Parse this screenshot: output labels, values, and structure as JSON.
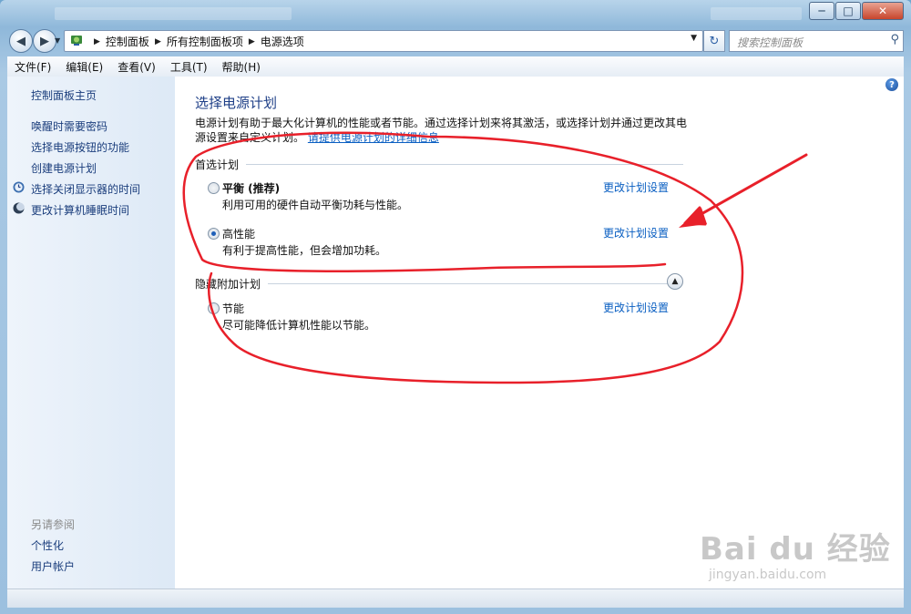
{
  "window": {
    "controls": {
      "minimize": "─",
      "maximize": "□",
      "close": "✕"
    }
  },
  "address": {
    "crumbs": [
      "控制面板",
      "所有控制面板项",
      "电源选项"
    ],
    "search_placeholder": "搜索控制面板"
  },
  "menu": [
    "文件(F)",
    "编辑(E)",
    "查看(V)",
    "工具(T)",
    "帮助(H)"
  ],
  "sidebar": {
    "home": "控制面板主页",
    "links": [
      "唤醒时需要密码",
      "选择电源按钮的功能",
      "创建电源计划",
      "选择关闭显示器的时间",
      "更改计算机睡眠时间"
    ],
    "see_also_title": "另请参阅",
    "see_also": [
      "个性化",
      "用户帐户"
    ]
  },
  "main": {
    "title": "选择电源计划",
    "description": "电源计划有助于最大化计算机的性能或者节能。通过选择计划来将其激活，或选择计划并通过更改其电源设置来自定义计划。",
    "more_info_link": "请提供电源计划的详细信息",
    "preferred_header": "首选计划",
    "hidden_header": "隐藏附加计划",
    "change_link": "更改计划设置",
    "plans": [
      {
        "name": "平衡 (推荐)",
        "desc": "利用可用的硬件自动平衡功耗与性能。",
        "selected": false
      },
      {
        "name": "高性能",
        "desc": "有利于提高性能，但会增加功耗。",
        "selected": true
      },
      {
        "name": "节能",
        "desc": "尽可能降低计算机性能以节能。",
        "selected": false
      }
    ]
  },
  "watermark": {
    "brand": "Bai du 经验",
    "url": "jingyan.baidu.com"
  },
  "colors": {
    "annotation": "#e8202a",
    "link": "#0a5fc2",
    "title": "#1e3f87"
  }
}
